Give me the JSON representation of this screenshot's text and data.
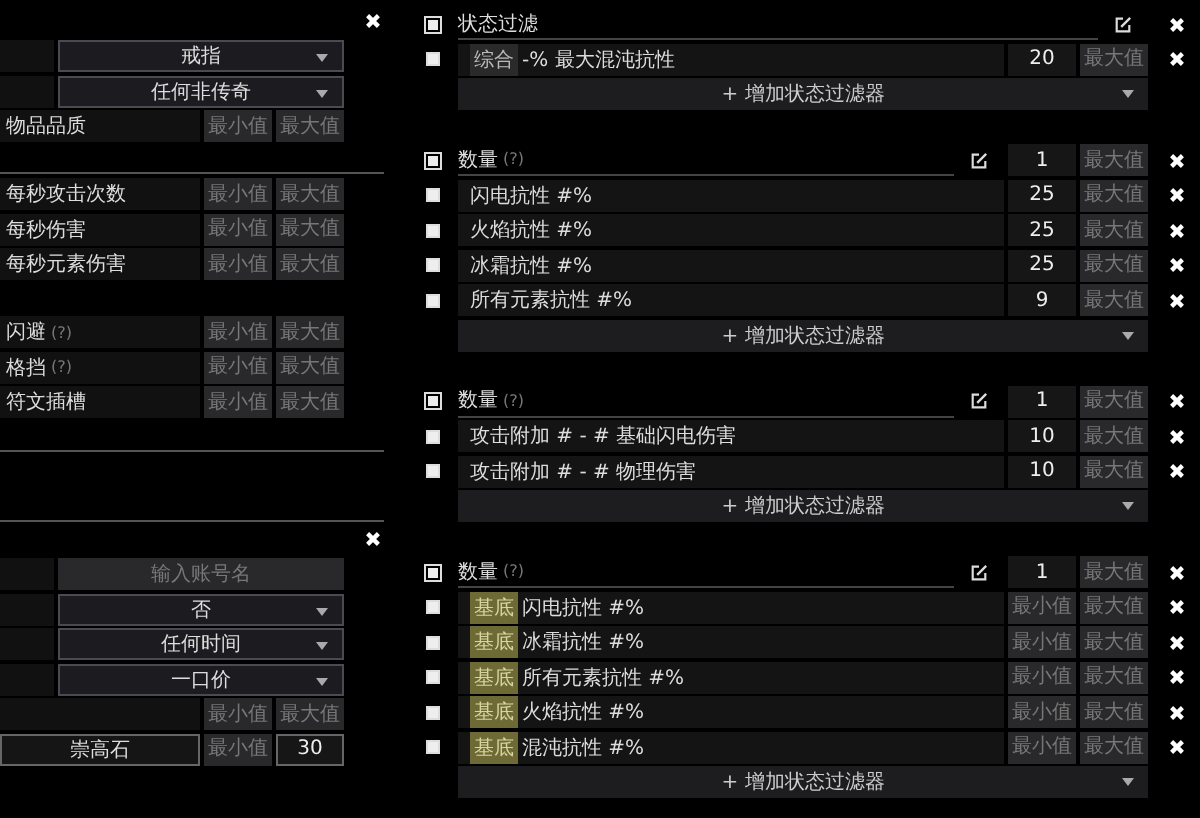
{
  "left_panel": {
    "sections": [
      {
        "closable": true,
        "rows": [
          {
            "kind": "select",
            "value": "戒指"
          },
          {
            "kind": "select",
            "value": "任何非传奇"
          },
          {
            "kind": "range",
            "label": "物品品质",
            "min": {
              "placeholder": "最小值"
            },
            "max": {
              "placeholder": "最大值"
            }
          }
        ]
      },
      {
        "closable": false,
        "rows": [
          {
            "kind": "range",
            "label": "每秒攻击次数",
            "min": {
              "placeholder": "最小值"
            },
            "max": {
              "placeholder": "最大值"
            }
          },
          {
            "kind": "range",
            "label": "每秒伤害",
            "min": {
              "placeholder": "最小值"
            },
            "max": {
              "placeholder": "最大值"
            }
          },
          {
            "kind": "range",
            "label": "每秒元素伤害",
            "min": {
              "placeholder": "最小值"
            },
            "max": {
              "placeholder": "最大值"
            }
          }
        ]
      },
      {
        "closable": false,
        "rows": [
          {
            "kind": "range",
            "label": "闪避",
            "hint": "(?)",
            "min": {
              "placeholder": "最小值"
            },
            "max": {
              "placeholder": "最大值"
            }
          },
          {
            "kind": "range",
            "label": "格挡",
            "hint": "(?)",
            "min": {
              "placeholder": "最小值"
            },
            "max": {
              "placeholder": "最大值"
            }
          },
          {
            "kind": "range",
            "label": "符文插槽",
            "min": {
              "placeholder": "最小值"
            },
            "max": {
              "placeholder": "最大值"
            }
          }
        ]
      },
      {
        "closable": true,
        "rows": [
          {
            "kind": "input",
            "placeholder": "输入账号名"
          },
          {
            "kind": "select",
            "value": "否"
          },
          {
            "kind": "select",
            "value": "任何时间"
          },
          {
            "kind": "select",
            "value": "一口价"
          },
          {
            "kind": "range",
            "min": {
              "placeholder": "最小值"
            },
            "max": {
              "placeholder": "最大值"
            }
          },
          {
            "kind": "currency",
            "currency": "崇高石",
            "min": {
              "placeholder": "最小值"
            },
            "max": {
              "value": "30"
            }
          }
        ]
      }
    ]
  },
  "stat_groups": [
    {
      "checked": true,
      "title": "状态过滤",
      "add_label": "+ 增加状态过滤器",
      "stats": [
        {
          "checked": true,
          "tag": {
            "text": "综合",
            "kind": "pseudo"
          },
          "text": "-% 最大混沌抗性",
          "min": {
            "value": "20"
          },
          "max": {
            "placeholder": "最大值"
          }
        }
      ]
    },
    {
      "checked": true,
      "title": "数量",
      "hint": "(?)",
      "min": {
        "value": "1"
      },
      "max": {
        "placeholder": "最大值"
      },
      "add_label": "+ 增加状态过滤器",
      "stats": [
        {
          "checked": true,
          "text": "闪电抗性 #%",
          "min": {
            "value": "25"
          },
          "max": {
            "placeholder": "最大值"
          }
        },
        {
          "checked": true,
          "text": "火焰抗性 #%",
          "min": {
            "value": "25"
          },
          "max": {
            "placeholder": "最大值"
          }
        },
        {
          "checked": true,
          "text": "冰霜抗性 #%",
          "min": {
            "value": "25"
          },
          "max": {
            "placeholder": "最大值"
          }
        },
        {
          "checked": true,
          "text": "所有元素抗性 #%",
          "min": {
            "value": "9"
          },
          "max": {
            "placeholder": "最大值"
          }
        }
      ]
    },
    {
      "checked": true,
      "title": "数量",
      "hint": "(?)",
      "min": {
        "value": "1"
      },
      "max": {
        "placeholder": "最大值"
      },
      "add_label": "+ 增加状态过滤器",
      "stats": [
        {
          "checked": true,
          "text": "攻击附加 # - # 基础闪电伤害",
          "min": {
            "value": "10"
          },
          "max": {
            "placeholder": "最大值"
          }
        },
        {
          "checked": true,
          "text": "攻击附加 # - # 物理伤害",
          "min": {
            "value": "10"
          },
          "max": {
            "placeholder": "最大值"
          }
        }
      ]
    },
    {
      "checked": true,
      "title": "数量",
      "hint": "(?)",
      "min": {
        "value": "1"
      },
      "max": {
        "placeholder": "最大值"
      },
      "add_label": "+ 增加状态过滤器",
      "stats": [
        {
          "checked": true,
          "tag": {
            "text": "基底",
            "kind": "base"
          },
          "text": "闪电抗性 #%",
          "min": {
            "placeholder": "最小值"
          },
          "max": {
            "placeholder": "最大值"
          }
        },
        {
          "checked": true,
          "tag": {
            "text": "基底",
            "kind": "base"
          },
          "text": "冰霜抗性 #%",
          "min": {
            "placeholder": "最小值"
          },
          "max": {
            "placeholder": "最大值"
          }
        },
        {
          "checked": true,
          "tag": {
            "text": "基底",
            "kind": "base"
          },
          "text": "所有元素抗性 #%",
          "min": {
            "placeholder": "最小值"
          },
          "max": {
            "placeholder": "最大值"
          }
        },
        {
          "checked": true,
          "tag": {
            "text": "基底",
            "kind": "base"
          },
          "text": "火焰抗性 #%",
          "min": {
            "placeholder": "最小值"
          },
          "max": {
            "placeholder": "最大值"
          }
        },
        {
          "checked": true,
          "tag": {
            "text": "基底",
            "kind": "base"
          },
          "text": "混沌抗性 #%",
          "min": {
            "placeholder": "最小值"
          },
          "max": {
            "placeholder": "最大值"
          }
        }
      ]
    }
  ]
}
